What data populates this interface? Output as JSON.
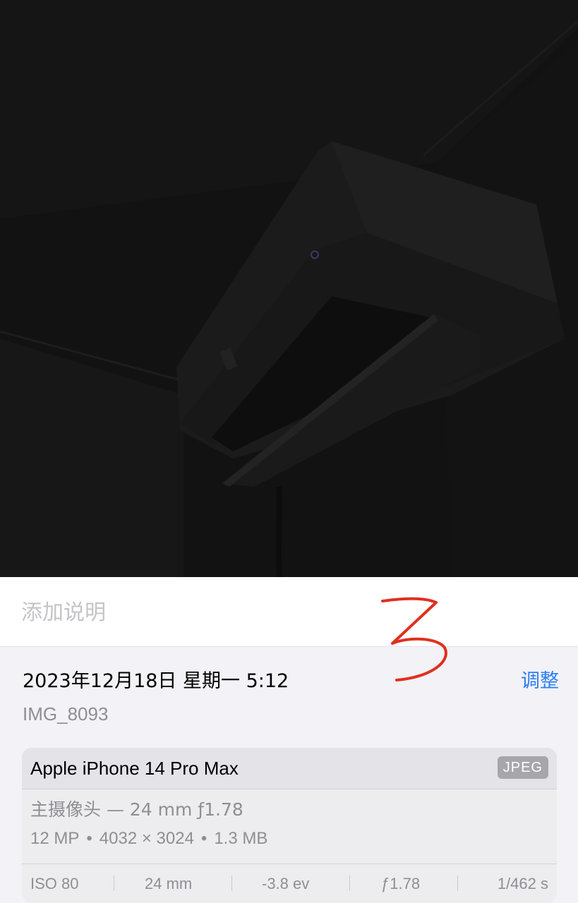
{
  "caption": {
    "placeholder": "添加说明"
  },
  "annotation": {
    "text": "3",
    "color": "#e0301e"
  },
  "info": {
    "datetime": "2023年12月18日 星期一 5:12",
    "adjust_label": "调整",
    "filename": "IMG_8093"
  },
  "camera": {
    "device": "Apple iPhone 14 Pro Max",
    "format": "JPEG",
    "lens": "主摄像头 — 24 mm ƒ1.78",
    "specs": {
      "megapixels": "12 MP",
      "resolution": "4032 × 3024",
      "size": "1.3 MB"
    },
    "exif": {
      "iso": "ISO 80",
      "focal": "24 mm",
      "ev": "-3.8 ev",
      "aperture": "ƒ1.78",
      "shutter": "1/462 s"
    }
  },
  "colors": {
    "accent": "#2f7df6",
    "secondary_text": "#8e8e93",
    "background": "#f2f2f7"
  }
}
